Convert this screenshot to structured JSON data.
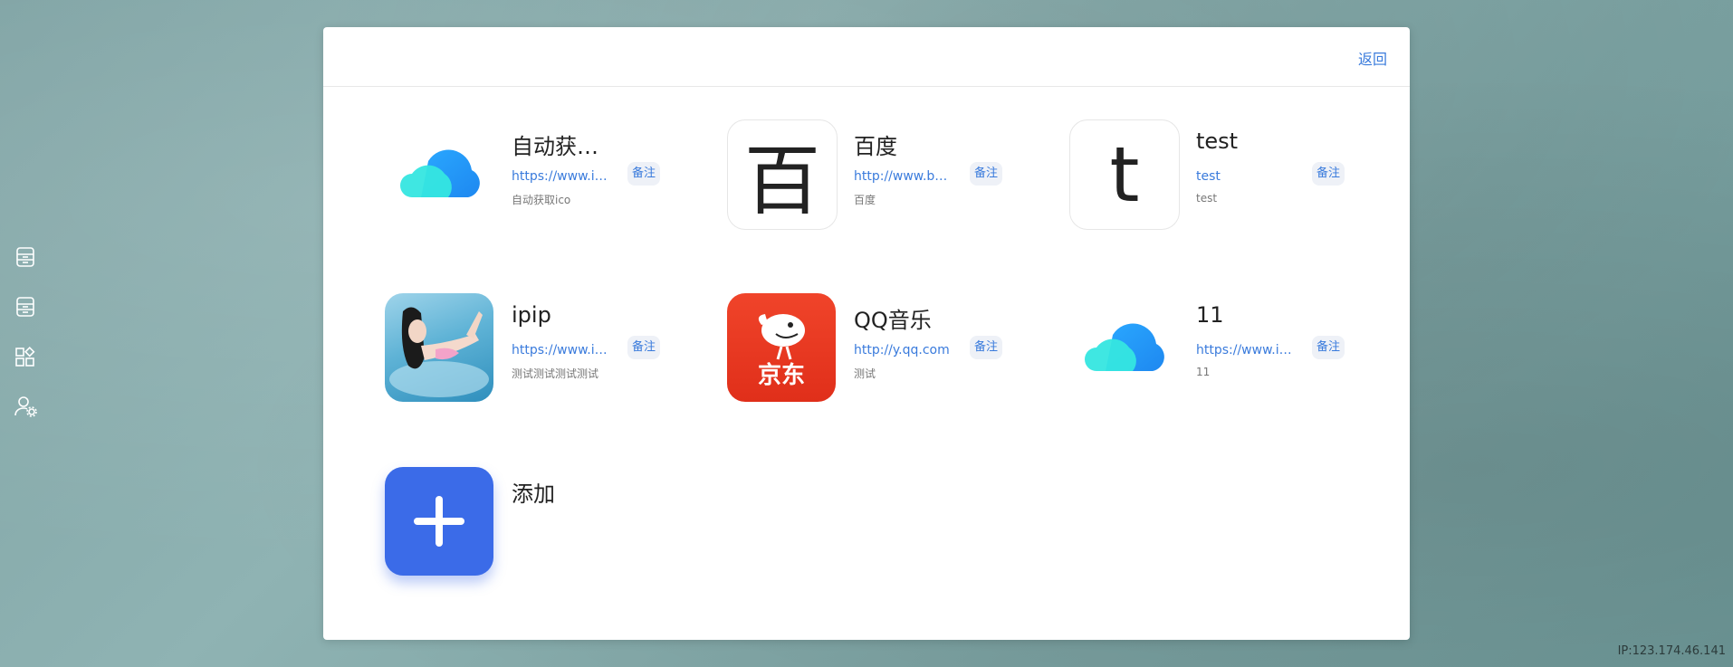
{
  "sidebar": {
    "icons": [
      "archive-icon",
      "archive-icon",
      "apps-icon",
      "user-settings-icon"
    ]
  },
  "panel": {
    "back_label": "返回"
  },
  "cards": [
    {
      "title": "自动获取ico",
      "url": "https://www.imgtp.com",
      "desc": "自动获取ico",
      "note": "备注",
      "icon": "cloud-icon"
    },
    {
      "title": "百度",
      "url": "http://www.baidu.com",
      "desc": "百度",
      "note": "备注",
      "icon_text": "百"
    },
    {
      "title": "test",
      "url": "test",
      "desc": "test",
      "note": "备注",
      "icon_text": "t"
    },
    {
      "title": "ipip",
      "url": "https://www.ipip.net",
      "desc": "测试测试测试测试",
      "note": "备注",
      "icon": "photo-icon"
    },
    {
      "title": "QQ音乐",
      "url": "http://y.qq.com",
      "desc": "测试",
      "note": "备注",
      "icon": "jd-logo",
      "icon_text": "京东"
    },
    {
      "title": "11",
      "url": "https://www.imgtp.com",
      "desc": "11",
      "note": "备注",
      "icon": "cloud-icon"
    }
  ],
  "add": {
    "label": "添加",
    "icon": "plus-icon"
  },
  "ip_text": "IP:123.174.46.141",
  "colors": {
    "accent": "#3a7bdc",
    "add_bg": "#3b6be8",
    "jd_red": "#e8351f"
  }
}
